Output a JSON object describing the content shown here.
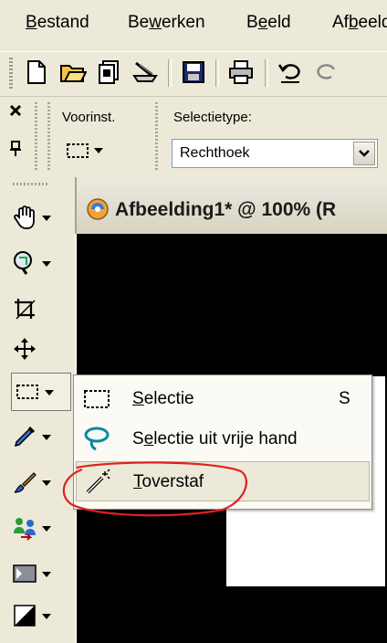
{
  "menubar": {
    "items": [
      {
        "label_pre": "",
        "label_ul": "B",
        "label_post": "estand"
      },
      {
        "label_pre": "Be",
        "label_ul": "w",
        "label_post": "erken"
      },
      {
        "label_pre": "B",
        "label_ul": "e",
        "label_post": "eld"
      },
      {
        "label_pre": "Af",
        "label_ul": "b",
        "label_post": "eeld"
      }
    ]
  },
  "options": {
    "preset_label": "Voorinst.",
    "selection_type_label": "Selectietype:",
    "selection_type_value": "Rechthoek"
  },
  "document": {
    "title": "Afbeelding1* @ 100% (R"
  },
  "flyout": {
    "items": [
      {
        "label_ul": "S",
        "label_rest": "electie",
        "shortcut": "S",
        "icon": "rect-select-icon"
      },
      {
        "label_pre": "S",
        "label_ul": "e",
        "label_rest": "lectie uit vrije hand",
        "icon": "lasso-icon"
      },
      {
        "label_ul": "T",
        "label_rest": "overstaf",
        "icon": "magic-wand-icon"
      }
    ]
  },
  "colors": {
    "chrome": "#ece9d8",
    "canvas": "#000000",
    "annotation": "#e02020"
  }
}
